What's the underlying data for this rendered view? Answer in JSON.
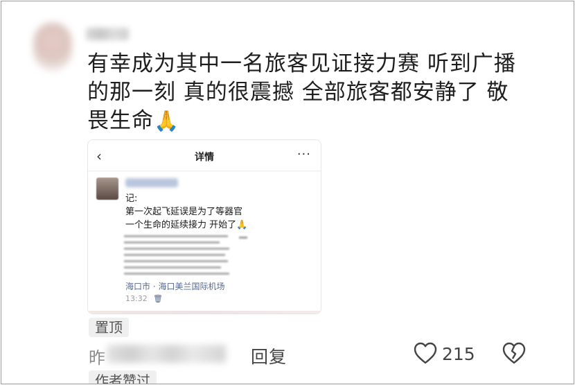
{
  "comment": {
    "text": "有幸成为其中一名旅客见证接力赛 听到广播的那一刻 真的很震撼 全部旅客都安静了 敬畏生命",
    "emoji": "🙏"
  },
  "embedded_screenshot": {
    "header_title": "详情",
    "back_icon": "chevron-left-icon",
    "more_icon": "ellipsis-icon",
    "post_line1": "记:",
    "post_line2": "第一次起飞延误是为了等器官",
    "post_line3": "一个生命的延续接力 开始了🙏",
    "location": "海口市 · 海口美兰国际机场",
    "time": "13:32",
    "delete_icon": "trash-icon"
  },
  "pin_label": "置顶",
  "time_prefix": "昨",
  "reply_label": "回复",
  "like_count": "215",
  "author_tag": "作者赞过",
  "colors": {
    "link": "#57698f",
    "badge_bg": "#efefef",
    "text": "#1e1e1e"
  }
}
